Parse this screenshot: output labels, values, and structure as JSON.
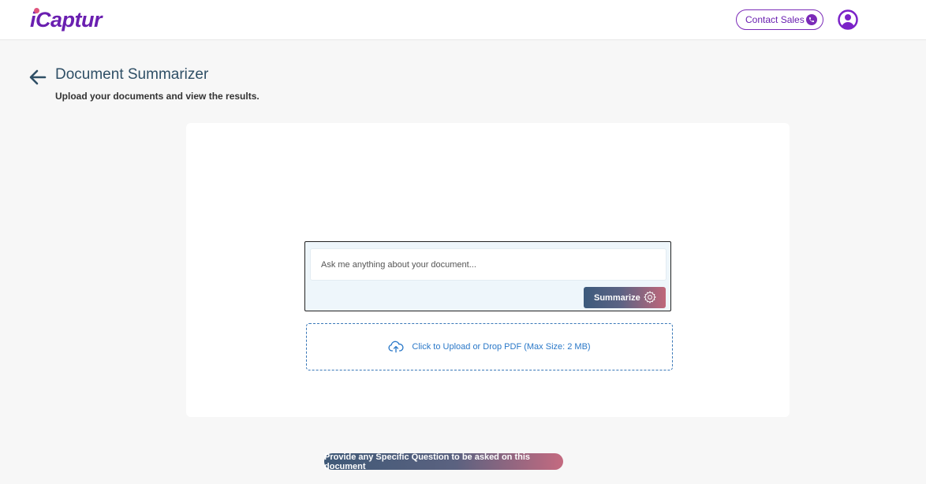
{
  "header": {
    "logo_text": "iCaptur",
    "contact_label": "Contact Sales"
  },
  "page": {
    "title": "Document Summarizer",
    "subtitle": "Upload your documents and view the results."
  },
  "query": {
    "placeholder": "Ask me anything about your document...",
    "value": "",
    "summarize_label": "Summarize"
  },
  "upload": {
    "label": "Click to Upload or Drop PDF (Max Size: 2 MB)"
  },
  "hint": {
    "text": "Provide any Specific Question to be asked on this document"
  },
  "icons": {
    "back": "arrow-left-icon",
    "phone": "phone-icon",
    "user": "user-avatar-icon",
    "gear": "gear-icon",
    "upload": "cloud-upload-icon"
  },
  "colors": {
    "brand_purple": "#6a1fb0",
    "title_blue": "#2f4f66",
    "link_blue": "#2a78c8",
    "gradient_start": "#3c5a7c",
    "gradient_end": "#c0677a"
  }
}
